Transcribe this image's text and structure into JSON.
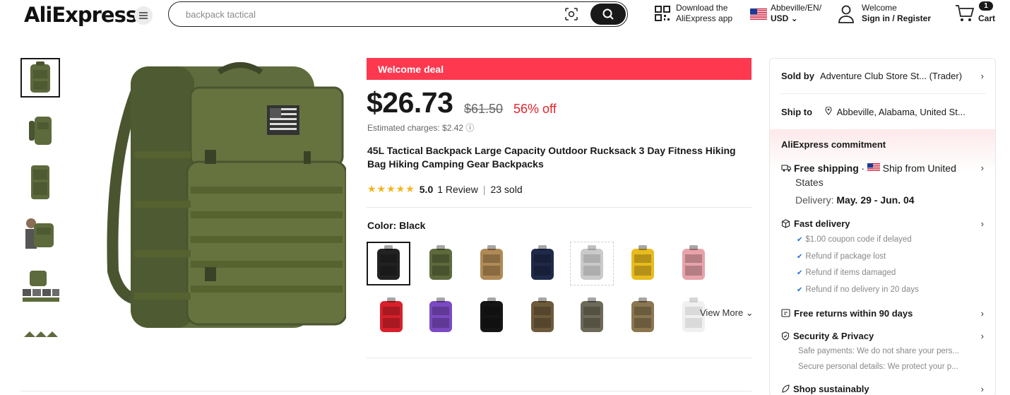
{
  "header": {
    "logo": "AliExpress",
    "search_placeholder": "backpack tactical",
    "download_line1": "Download the",
    "download_line2": "AliExpress app",
    "lang_line1": "Abbeville/EN/",
    "lang_line2": "USD ⌄",
    "welcome_line1": "Welcome",
    "welcome_line2": "Sign in / Register",
    "cart_count": "1",
    "cart_label": "Cart"
  },
  "product": {
    "deal_label": "Welcome deal",
    "price": "$26.73",
    "old_price": "$61.50",
    "discount": "56% off",
    "estimated": "Estimated charges: $2.42 ⓘ",
    "title": "45L Tactical Backpack Large Capacity Outdoor Rucksack 3 Day Fitness Hiking Bag Hiking Camping Gear Backpacks",
    "stars": "★★★★★",
    "score": "5.0",
    "reviews": "1 Review",
    "sold": "23 sold",
    "color_label": "Color: Black",
    "view_more": "View More ⌄",
    "swatch_colors": [
      "#222222",
      "#5d6a3c",
      "#b08a55",
      "#1f2a4a",
      "#b5b5b5",
      "#e8bb1e",
      "#e8a2aa",
      "#d8202c",
      "#7b4ac2",
      "#151515",
      "#6d5a3a",
      "#6e6a58",
      "#8a7650",
      "#e0e0e0"
    ]
  },
  "panel": {
    "sold_by_label": "Sold by",
    "sold_by_value": "Adventure Club Store St... (Trader)",
    "ship_to_label": "Ship to",
    "ship_to_value": "Abbeville, Alabama, United St...",
    "commitment": "AliExpress commitment",
    "free_shipping": "Free shipping",
    "ship_from": "Ship from United",
    "ship_from2": "States",
    "delivery_label": "Delivery:",
    "delivery_value": "May. 29 - Jun. 04",
    "fast_delivery": "Fast delivery",
    "fd_items": [
      "$1.00 coupon code if delayed",
      "Refund if package lost",
      "Refund if items damaged",
      "Refund if no delivery in 20 days"
    ],
    "free_returns": "Free returns within 90 days",
    "security": "Security & Privacy",
    "sec_line1": "Safe payments: We do not share your pers...",
    "sec_line2": "Secure personal details: We protect your p...",
    "shop_sustainably": "Shop sustainably"
  },
  "colors": {
    "accent": "#fd384f",
    "discount": "#e3242b",
    "star": "#f7b31b"
  }
}
